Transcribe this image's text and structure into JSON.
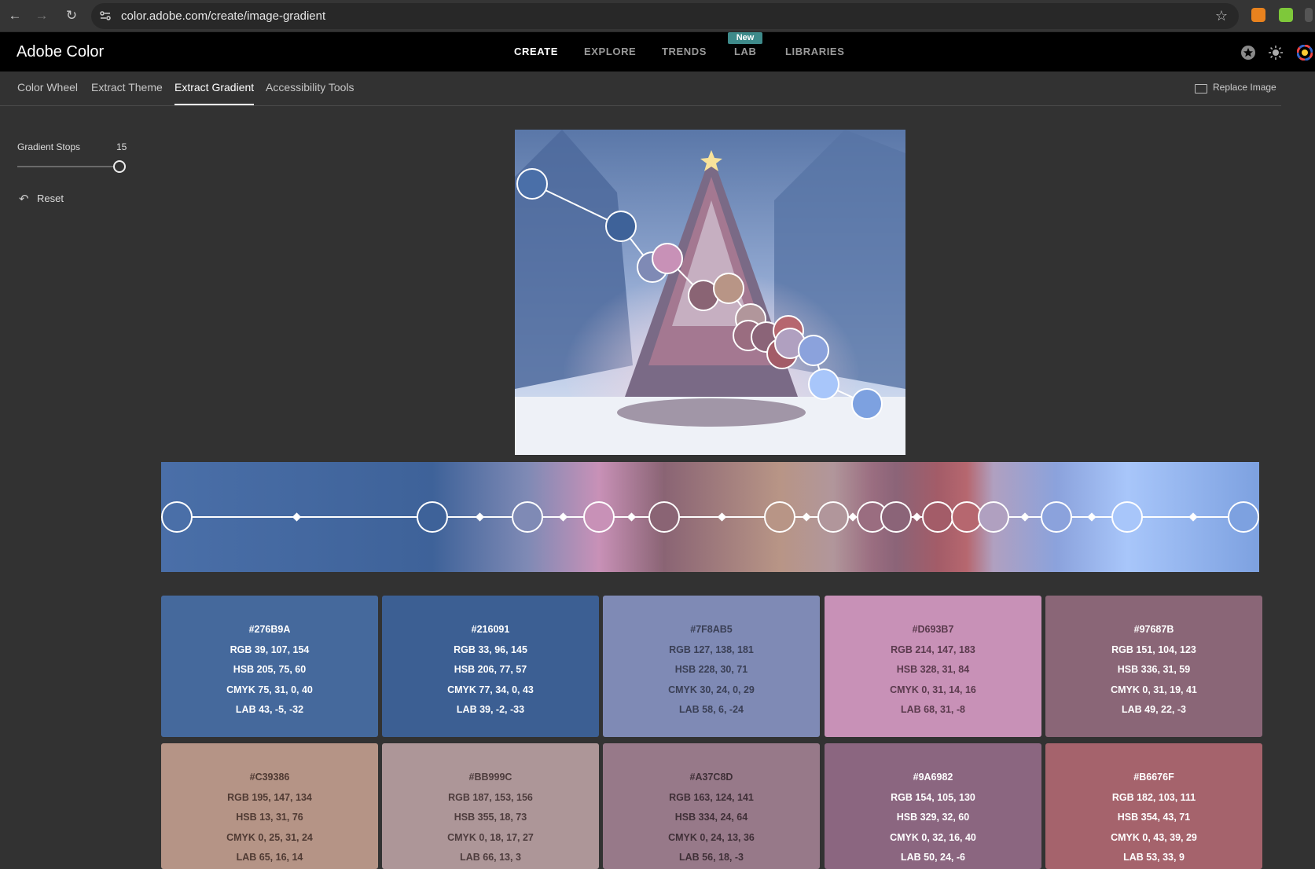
{
  "browser": {
    "url": "color.adobe.com/create/image-gradient"
  },
  "app": {
    "title": "Adobe Color",
    "nav": [
      {
        "label": "CREATE",
        "active": true
      },
      {
        "label": "EXPLORE",
        "active": false
      },
      {
        "label": "TRENDS",
        "active": false
      },
      {
        "label": "LAB",
        "active": false
      },
      {
        "label": "LIBRARIES",
        "active": false
      }
    ],
    "new_badge": "New"
  },
  "subtabs": [
    {
      "label": "Color Wheel",
      "active": false
    },
    {
      "label": "Extract Theme",
      "active": false
    },
    {
      "label": "Extract Gradient",
      "active": true
    },
    {
      "label": "Accessibility Tools",
      "active": false
    }
  ],
  "replace_image": "Replace Image",
  "controls": {
    "gradient_stops_label": "Gradient Stops",
    "gradient_stops_value": "15",
    "reset_label": "Reset"
  },
  "image": {
    "description_icon": "christmas-tree-image"
  },
  "gradient": {
    "stop_colors": [
      "#4a6fa8",
      "#3e6299",
      "#7f8ab5",
      "#c891b7",
      "#8a6474",
      "#b89586",
      "#b1969b",
      "#9a6d80",
      "#8b6478",
      "#a35c68",
      "#b6676f",
      "#b0a0c0",
      "#8ba2dc",
      "#a8c6fa",
      "#7da1e0"
    ]
  },
  "swatches": [
    {
      "hex": "#276B9A",
      "rgb": "RGB 39, 107, 154",
      "hsb": "HSB 205, 75, 60",
      "cmyk": "CMYK 75, 31, 0, 40",
      "lab": "LAB 43, -5, -32",
      "bg": "#45699c",
      "fg": "#ffffff"
    },
    {
      "hex": "#216091",
      "rgb": "RGB 33, 96, 145",
      "hsb": "HSB 206, 77, 57",
      "cmyk": "CMYK 77, 34, 0, 43",
      "lab": "LAB 39, -2, -33",
      "bg": "#3c5f93",
      "fg": "#ffffff"
    },
    {
      "hex": "#7F8AB5",
      "rgb": "RGB 127, 138, 181",
      "hsb": "HSB 228, 30, 71",
      "cmyk": "CMYK 30, 24, 0, 29",
      "lab": "LAB 58, 6, -24",
      "bg": "#7f8ab5",
      "fg": "#3a3f55"
    },
    {
      "hex": "#D693B7",
      "rgb": "RGB 214, 147, 183",
      "hsb": "HSB 328, 31, 84",
      "cmyk": "CMYK 0, 31, 14, 16",
      "lab": "LAB 68, 31, -8",
      "bg": "#c891b7",
      "fg": "#5a3a4d"
    },
    {
      "hex": "#97687B",
      "rgb": "RGB 151, 104, 123",
      "hsb": "HSB 336, 31, 59",
      "cmyk": "CMYK 0, 31, 19, 41",
      "lab": "LAB 49, 22, -3",
      "bg": "#8a6677",
      "fg": "#ffffff"
    },
    {
      "hex": "#C39386",
      "rgb": "RGB 195, 147, 134",
      "hsb": "HSB 13, 31, 76",
      "cmyk": "CMYK 0, 25, 31, 24",
      "lab": "LAB 65, 16, 14",
      "bg": "#b59486",
      "fg": "#4f3a33"
    },
    {
      "hex": "#BB999C",
      "rgb": "RGB 187, 153, 156",
      "hsb": "HSB 355, 18, 73",
      "cmyk": "CMYK 0, 18, 17, 27",
      "lab": "LAB 66, 13, 3",
      "bg": "#ad9698",
      "fg": "#4d3c3d"
    },
    {
      "hex": "#A37C8D",
      "rgb": "RGB 163, 124, 141",
      "hsb": "HSB 334, 24, 64",
      "cmyk": "CMYK 0, 24, 13, 36",
      "lab": "LAB 56, 18, -3",
      "bg": "#977989",
      "fg": "#3f2f37"
    },
    {
      "hex": "#9A6982",
      "rgb": "RGB 154, 105, 130",
      "hsb": "HSB 329, 32, 60",
      "cmyk": "CMYK 0, 32, 16, 40",
      "lab": "LAB 50, 24, -6",
      "bg": "#8b6680",
      "fg": "#ffffff"
    },
    {
      "hex": "#B6676F",
      "rgb": "RGB 182, 103, 111",
      "hsb": "HSB 354, 43, 71",
      "cmyk": "CMYK 0, 43, 39, 29",
      "lab": "LAB 53, 33, 9",
      "bg": "#a5636c",
      "fg": "#ffffff"
    }
  ]
}
